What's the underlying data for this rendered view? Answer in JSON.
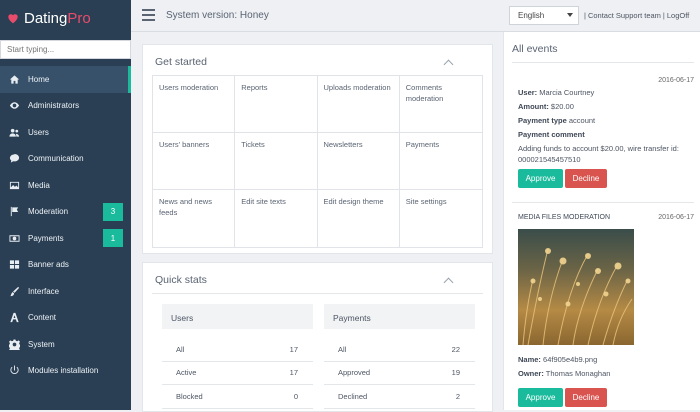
{
  "logo": {
    "text_main": "Dating",
    "text_pro": "Pro"
  },
  "search": {
    "placeholder": "Start typing..."
  },
  "nav": [
    {
      "label": "Home",
      "icon": "home-icon",
      "active": true,
      "badge": ""
    },
    {
      "label": "Administrators",
      "icon": "eye-icon",
      "active": false,
      "badge": ""
    },
    {
      "label": "Users",
      "icon": "users-icon",
      "active": false,
      "badge": ""
    },
    {
      "label": "Communication",
      "icon": "chat-icon",
      "active": false,
      "badge": ""
    },
    {
      "label": "Media",
      "icon": "image-icon",
      "active": false,
      "badge": ""
    },
    {
      "label": "Moderation",
      "icon": "flag-icon",
      "active": false,
      "badge": "3"
    },
    {
      "label": "Payments",
      "icon": "money-icon",
      "active": false,
      "badge": "1"
    },
    {
      "label": "Banner ads",
      "icon": "grid-icon",
      "active": false,
      "badge": ""
    },
    {
      "label": "Interface",
      "icon": "brush-icon",
      "active": false,
      "badge": ""
    },
    {
      "label": "Content",
      "icon": "font-icon",
      "active": false,
      "badge": ""
    },
    {
      "label": "System",
      "icon": "gear-icon",
      "active": false,
      "badge": ""
    },
    {
      "label": "Modules installation",
      "icon": "power-icon",
      "active": false,
      "badge": ""
    }
  ],
  "topbar": {
    "system_version": "System version: Honey",
    "language": "English",
    "support_link": "Contact Support team",
    "logoff_link": "LogOff"
  },
  "get_started": {
    "title": "Get started",
    "items": [
      "Users moderation",
      "Reports",
      "Uploads moderation",
      "Comments moderation",
      "Users' banners",
      "Tickets",
      "Newsletters",
      "Payments",
      "News and news feeds",
      "Edit site texts",
      "Edit design theme",
      "Site settings"
    ]
  },
  "quick_stats": {
    "title": "Quick stats",
    "users": {
      "title": "Users",
      "rows": [
        {
          "label": "All",
          "value": "17"
        },
        {
          "label": "Active",
          "value": "17"
        },
        {
          "label": "Blocked",
          "value": "0"
        }
      ]
    },
    "payments": {
      "title": "Payments",
      "rows": [
        {
          "label": "All",
          "value": "22"
        },
        {
          "label": "Approved",
          "value": "19"
        },
        {
          "label": "Declined",
          "value": "2"
        }
      ]
    }
  },
  "events": {
    "title": "All events",
    "payment": {
      "date": "2016-06-17",
      "user_label": "User:",
      "user_value": "Marcia Courtney",
      "amount_label": "Amount:",
      "amount_value": "$20.00",
      "type_label": "Payment type",
      "type_value": "account",
      "comment_label": "Payment comment",
      "comment_text": "Adding funds to account $20.00, wire transfer id: 000021545457510",
      "approve": "Approve",
      "decline": "Decline"
    },
    "media": {
      "heading": "MEDIA FILES MODERATION",
      "date": "2016-06-17",
      "name_label": "Name:",
      "name_value": "64f905e4b9.png",
      "owner_label": "Owner:",
      "owner_value": "Thomas Monaghan",
      "approve": "Approve",
      "decline": "Decline"
    }
  },
  "colors": {
    "sidebar": "#2a3f54",
    "accent": "#1abb9c",
    "danger": "#d9534f",
    "brand_pink": "#e94b6b"
  }
}
